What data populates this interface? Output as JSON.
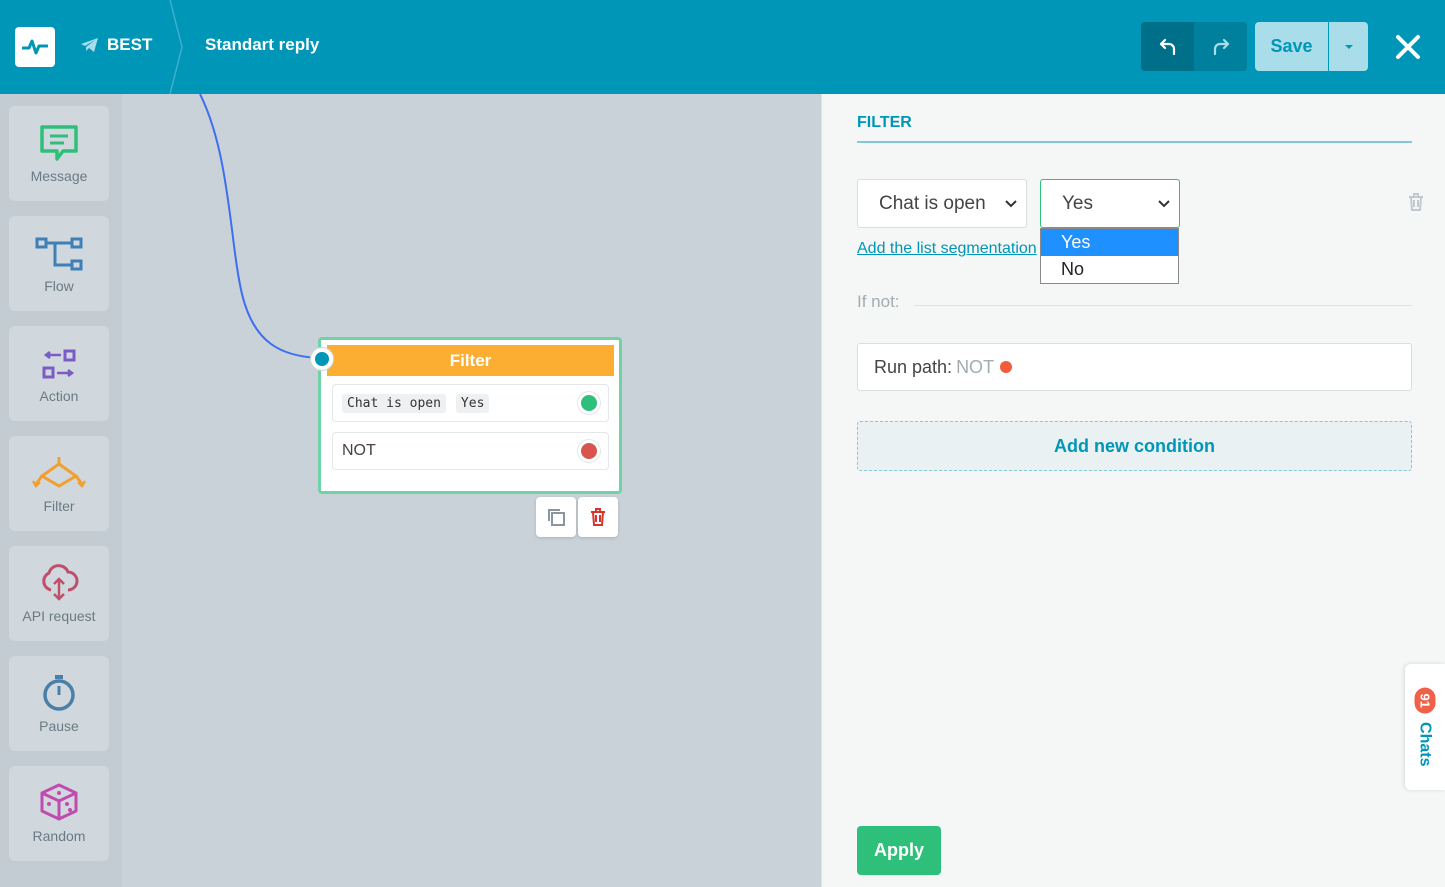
{
  "header": {
    "bot_name": "BEST",
    "flow_title": "Standart reply",
    "save_label": "Save"
  },
  "palette": {
    "items": [
      {
        "label": "Message",
        "icon": "message-icon",
        "color": "#2ebf7a"
      },
      {
        "label": "Flow",
        "icon": "flow-icon",
        "color": "#3d7fb6"
      },
      {
        "label": "Action",
        "icon": "action-icon",
        "color": "#7b5cc4"
      },
      {
        "label": "Filter",
        "icon": "filter-icon",
        "color": "#f0a030"
      },
      {
        "label": "API request",
        "icon": "api-request-icon",
        "color": "#c0506a"
      },
      {
        "label": "Pause",
        "icon": "pause-icon",
        "color": "#4a7fa8"
      },
      {
        "label": "Random",
        "icon": "random-icon",
        "color": "#c04cb0"
      }
    ]
  },
  "node": {
    "title": "Filter",
    "condition_field": "Chat is open",
    "condition_value": "Yes",
    "not_label": "NOT"
  },
  "panel": {
    "tab_label": "FILTER",
    "condition_select": "Chat is open",
    "value_select": "Yes",
    "dropdown_options": [
      "Yes",
      "No"
    ],
    "add_segmentation_link": "Add the list segmentation",
    "if_not_label": "If not:",
    "run_path_label": "Run path:",
    "run_path_value": "NOT",
    "add_condition_label": "Add new condition",
    "apply_label": "Apply"
  },
  "chats": {
    "label": "Chats",
    "count": "91"
  },
  "colors": {
    "brand": "#0096b7",
    "node_header": "#fbae32",
    "success": "#2ebf7a",
    "danger": "#f25c3c"
  }
}
